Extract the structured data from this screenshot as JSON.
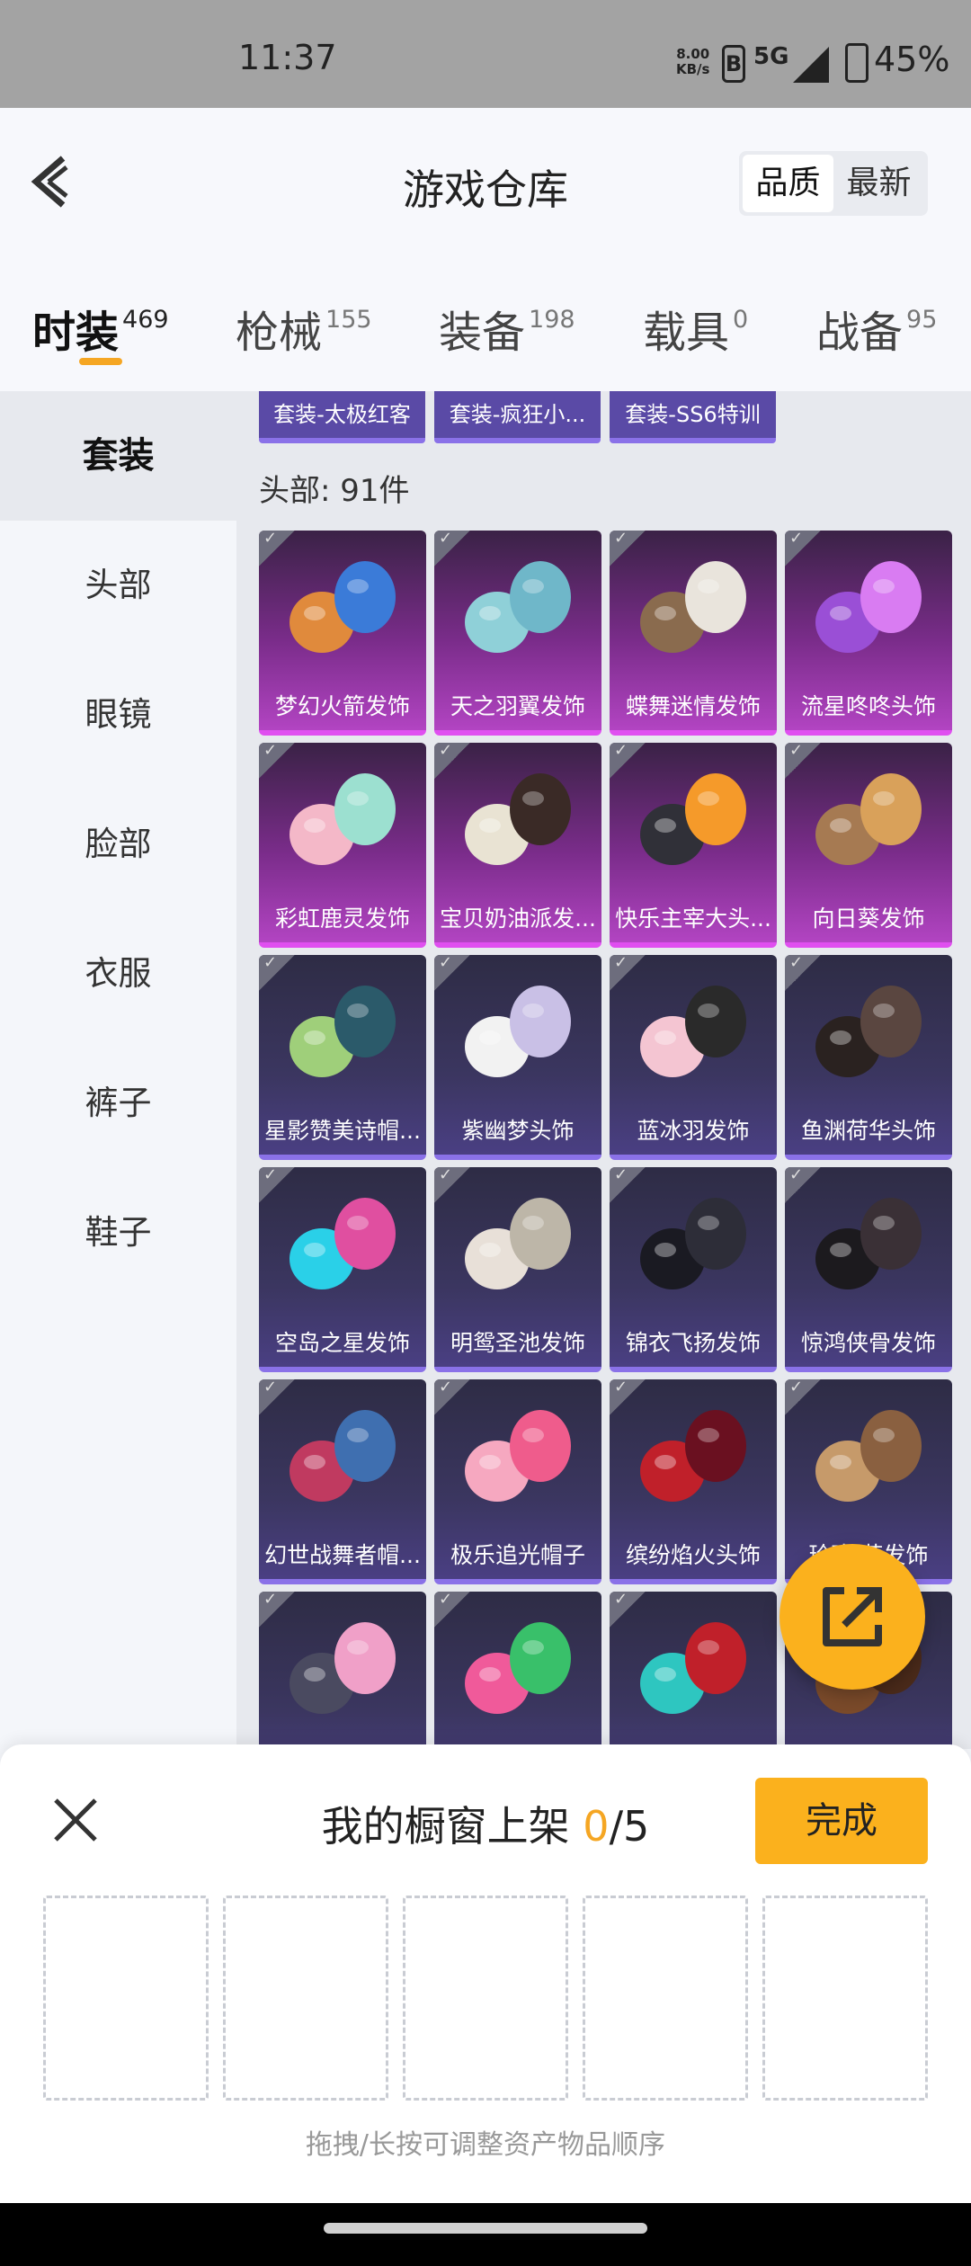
{
  "status_bar": {
    "time": "11:37",
    "speed_value": "8.00",
    "speed_unit": "KB/s",
    "network": "5G",
    "battery": "45%"
  },
  "header": {
    "title": "游戏仓库",
    "sort_options": [
      "品质",
      "最新"
    ],
    "active_sort": "品质"
  },
  "tabs": [
    {
      "label": "时装",
      "count": "469",
      "active": true
    },
    {
      "label": "枪械",
      "count": "155",
      "active": false
    },
    {
      "label": "装备",
      "count": "198",
      "active": false
    },
    {
      "label": "载具",
      "count": "0",
      "active": false
    },
    {
      "label": "战备",
      "count": "95",
      "active": false
    }
  ],
  "sidebar": {
    "items": [
      "套装",
      "头部",
      "眼镜",
      "脸部",
      "衣服",
      "裤子",
      "鞋子"
    ],
    "active": "套装"
  },
  "content": {
    "suit_tags": [
      "套装-太极红客",
      "套装-疯狂小...",
      "套装-SS6特训"
    ],
    "section_title": "头部: 91件",
    "items": [
      {
        "name": "梦幻火箭发饰",
        "rarity": "purple"
      },
      {
        "name": "天之羽翼发饰",
        "rarity": "purple"
      },
      {
        "name": "蝶舞迷情发饰",
        "rarity": "purple"
      },
      {
        "name": "流星咚咚头饰",
        "rarity": "purple"
      },
      {
        "name": "彩虹鹿灵发饰",
        "rarity": "purple"
      },
      {
        "name": "宝贝奶油派发...",
        "rarity": "purple"
      },
      {
        "name": "快乐主宰大头...",
        "rarity": "purple"
      },
      {
        "name": "向日葵发饰",
        "rarity": "purple"
      },
      {
        "name": "星影赞美诗帽...",
        "rarity": "blue"
      },
      {
        "name": "紫幽梦头饰",
        "rarity": "blue"
      },
      {
        "name": "蓝冰羽发饰",
        "rarity": "blue"
      },
      {
        "name": "鱼渊荷华头饰",
        "rarity": "blue"
      },
      {
        "name": "空岛之星发饰",
        "rarity": "blue"
      },
      {
        "name": "明鸳圣池发饰",
        "rarity": "blue"
      },
      {
        "name": "锦衣飞扬发饰",
        "rarity": "blue"
      },
      {
        "name": "惊鸿侠骨发饰",
        "rarity": "blue"
      },
      {
        "name": "幻世战舞者帽...",
        "rarity": "blue"
      },
      {
        "name": "极乐追光帽子",
        "rarity": "blue"
      },
      {
        "name": "缤纷焰火头饰",
        "rarity": "blue"
      },
      {
        "name": "玲珑·花发饰",
        "rarity": "blue"
      },
      {
        "name": "",
        "rarity": "blue"
      },
      {
        "name": "",
        "rarity": "blue"
      },
      {
        "name": "",
        "rarity": "blue"
      },
      {
        "name": "",
        "rarity": "blue"
      }
    ]
  },
  "panel": {
    "title_prefix": "我的橱窗上架 ",
    "current": "0",
    "total": "/5",
    "done_label": "完成",
    "hint": "拖拽/长按可调整资产物品顺序"
  },
  "colors": {
    "accent": "#fbb11d",
    "purple_rarity": "#b244c2",
    "blue_rarity": "#4a3f83"
  }
}
